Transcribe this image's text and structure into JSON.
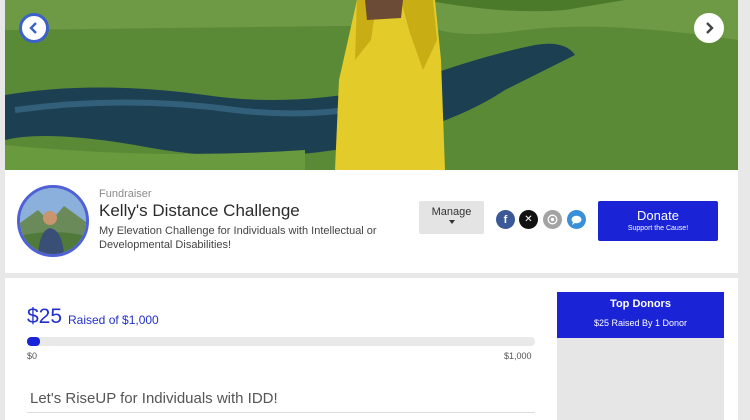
{
  "hero": {
    "prev_icon": "chevron-left-icon",
    "next_icon": "chevron-right-icon"
  },
  "header": {
    "eyebrow": "Fundraiser",
    "title": "Kelly's Distance Challenge",
    "subtitle": "My Elevation Challenge for Individuals with Intellectual or Developmental Disabilities!",
    "manage_label": "Manage",
    "donate_label": "Donate",
    "donate_sub": "Support the Cause!",
    "social": [
      {
        "name": "facebook-icon",
        "glyph": "f",
        "color": "#3b5998"
      },
      {
        "name": "x-icon",
        "glyph": "✕",
        "color": "#111111"
      },
      {
        "name": "email-icon",
        "glyph": "✉",
        "color": "#9a9a9a"
      },
      {
        "name": "chat-icon",
        "glyph": "💬",
        "color": "#3a8fd9"
      }
    ]
  },
  "progress": {
    "raised": "$25",
    "raised_of": "Raised of $1,000",
    "fraction": 0.025,
    "min_label": "$0",
    "max_label": "$1,000"
  },
  "campaign": {
    "title": "Let's RiseUP for Individuals with IDD!"
  },
  "donors": {
    "heading": "Top Donors",
    "summary": "$25 Raised By 1 Donor"
  },
  "colors": {
    "brand": "#1a23d6",
    "accent_text": "#2030c8"
  }
}
